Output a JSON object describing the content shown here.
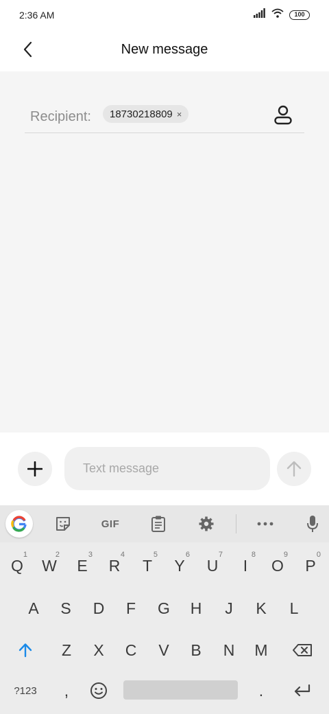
{
  "status_bar": {
    "time": "2:36 AM",
    "battery": "100"
  },
  "header": {
    "title": "New message"
  },
  "recipient": {
    "label": "Recipient:",
    "chip": "18730218809",
    "chip_close": "×"
  },
  "compose": {
    "placeholder": "Text message"
  },
  "keyboard": {
    "toolbar": {
      "gif": "GIF"
    },
    "row1": [
      {
        "key": "Q",
        "hint": "1"
      },
      {
        "key": "W",
        "hint": "2"
      },
      {
        "key": "E",
        "hint": "3"
      },
      {
        "key": "R",
        "hint": "4"
      },
      {
        "key": "T",
        "hint": "5"
      },
      {
        "key": "Y",
        "hint": "6"
      },
      {
        "key": "U",
        "hint": "7"
      },
      {
        "key": "I",
        "hint": "8"
      },
      {
        "key": "O",
        "hint": "9"
      },
      {
        "key": "P",
        "hint": "0"
      }
    ],
    "row2": [
      "A",
      "S",
      "D",
      "F",
      "G",
      "H",
      "J",
      "K",
      "L"
    ],
    "row3": [
      "Z",
      "X",
      "C",
      "V",
      "B",
      "N",
      "M"
    ],
    "row4": {
      "symbols": "?123",
      "comma": ",",
      "period": "."
    }
  }
}
